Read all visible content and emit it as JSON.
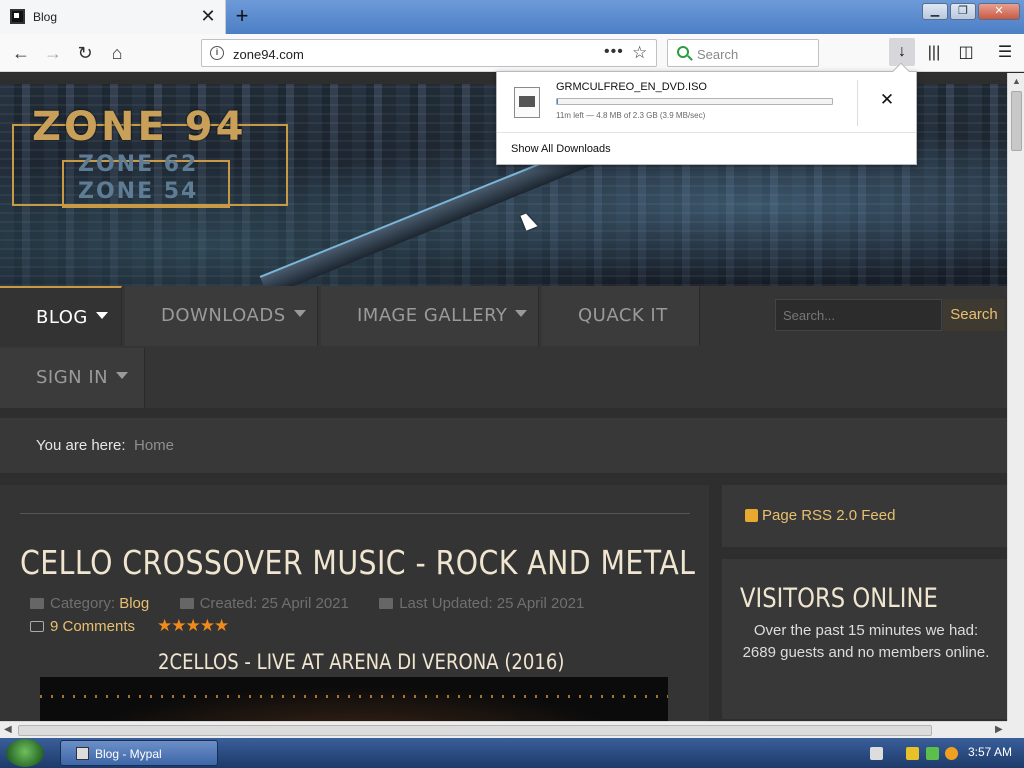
{
  "browser": {
    "tab_title": "Blog",
    "url": "zone94.com",
    "search_placeholder": "Search"
  },
  "download": {
    "file_name": "GRMCULFREO_EN_DVD.ISO",
    "status": "11m left — 4.8 MB of 2.3 GB (3.9 MB/sec)",
    "progress_percent": 0.2,
    "show_all": "Show All Downloads"
  },
  "site": {
    "logo_line1": "ZONE 94",
    "logo_line2": "ZONE 62",
    "logo_line3": "ZONE 54",
    "menu": [
      {
        "label": "BLOG"
      },
      {
        "label": "DOWNLOADS"
      },
      {
        "label": "IMAGE GALLERY"
      },
      {
        "label": "QUACK IT"
      },
      {
        "label": "SIGN IN"
      }
    ],
    "search_placeholder": "Search...",
    "search_button": "Search",
    "breadcrumb_label": "You are here:",
    "breadcrumb_home": "Home"
  },
  "article": {
    "title": "CELLO CROSSOVER MUSIC - ROCK AND METAL",
    "category_label": "Category:",
    "category": "Blog",
    "created": "Created: 25 April 2021",
    "updated": "Last Updated: 25 April 2021",
    "comments": "9 Comments",
    "rating_stars": 5,
    "subtitle": "2CELLOS - LIVE AT ARENA DI VERONA (2016)"
  },
  "sidebar": {
    "rss": "Page RSS 2.0 Feed",
    "visitors_title": "VISITORS ONLINE",
    "visitors_text": "Over the past 15 minutes we had: 2689 guests and no members online."
  },
  "taskbar": {
    "window_label": "Blog - Mypal",
    "clock": "3:57 AM"
  },
  "colors": {
    "accent": "#e7c070",
    "progress": "#3d8ad8",
    "stars": "#f08a1c"
  }
}
